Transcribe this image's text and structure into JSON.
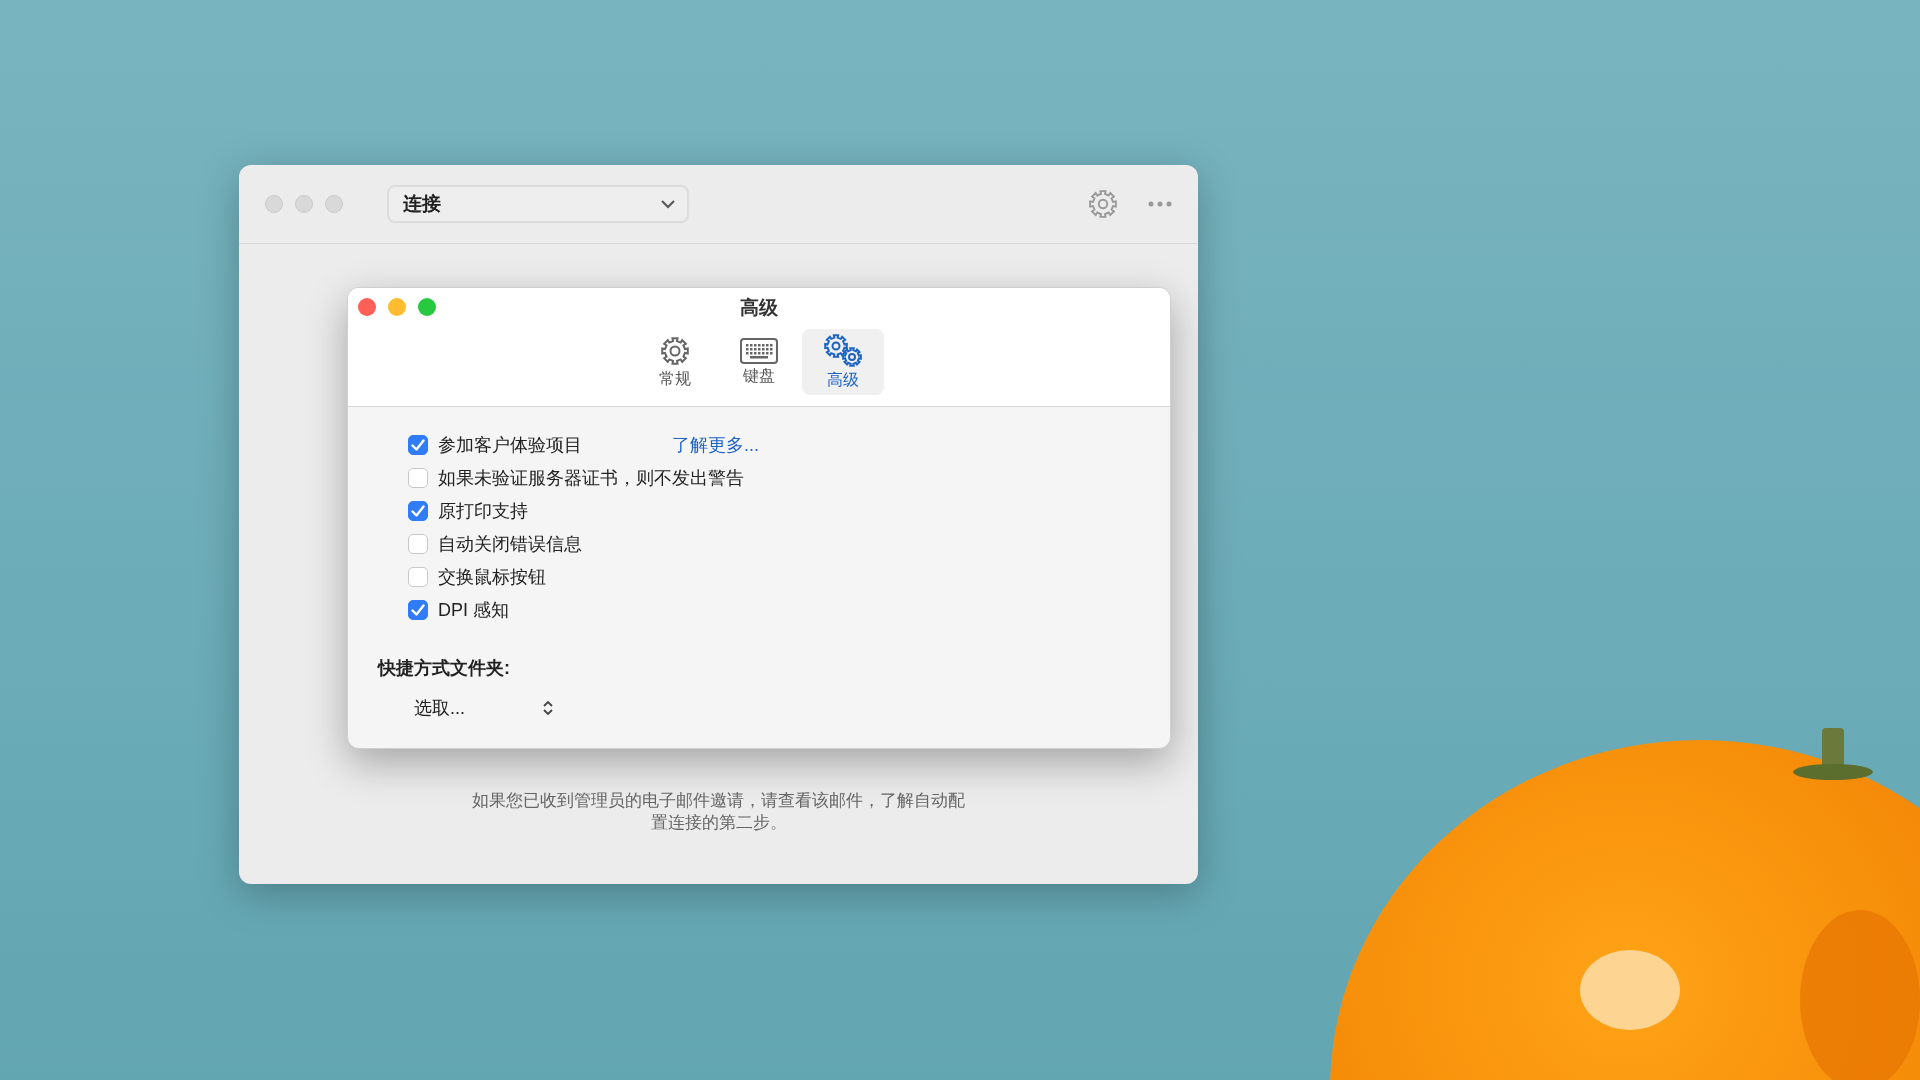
{
  "main_window": {
    "connection_select": {
      "value": "连接"
    },
    "info_text": "如果您已收到管理员的电子邮件邀请，请查看该邮件，了解自动配置连接的第二步。"
  },
  "dialog": {
    "title": "高级",
    "tabs": [
      {
        "label": "常规",
        "kind": "gear",
        "selected": false
      },
      {
        "label": "键盘",
        "kind": "keyboard",
        "selected": false
      },
      {
        "label": "高级",
        "kind": "gears",
        "selected": true
      }
    ],
    "options": [
      {
        "label": "参加客户体验项目",
        "checked": true,
        "link": "了解更多..."
      },
      {
        "label": "如果未验证服务器证书，则不发出警告",
        "checked": false
      },
      {
        "label": "原打印支持",
        "checked": true
      },
      {
        "label": "自动关闭错误信息",
        "checked": false
      },
      {
        "label": "交换鼠标按钮",
        "checked": false
      },
      {
        "label": "DPI 感知",
        "checked": true
      }
    ],
    "shortcut_folder": {
      "label": "快捷方式文件夹:",
      "value": "选取..."
    }
  }
}
